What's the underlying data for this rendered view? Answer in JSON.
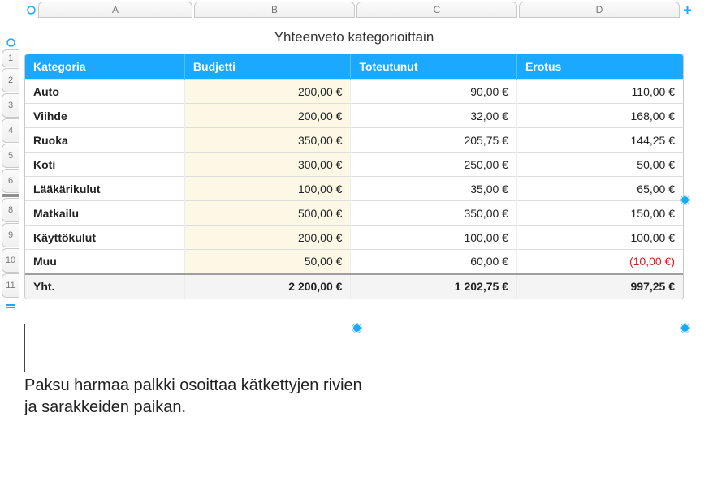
{
  "columns": [
    "A",
    "B",
    "C",
    "D"
  ],
  "row_numbers": [
    "1",
    "2",
    "3",
    "4",
    "5",
    "6",
    "8",
    "9",
    "10",
    "11"
  ],
  "hidden_gap_after_index": 5,
  "table": {
    "title": "Yhteenveto kategorioittain",
    "headers": [
      "Kategoria",
      "Budjetti",
      "Toteutunut",
      "Erotus"
    ],
    "rows": [
      {
        "cat": "Auto",
        "budget": "200,00 €",
        "actual": "90,00 €",
        "diff": "110,00 €",
        "neg": false
      },
      {
        "cat": "Viihde",
        "budget": "200,00 €",
        "actual": "32,00 €",
        "diff": "168,00 €",
        "neg": false
      },
      {
        "cat": "Ruoka",
        "budget": "350,00 €",
        "actual": "205,75 €",
        "diff": "144,25 €",
        "neg": false
      },
      {
        "cat": "Koti",
        "budget": "300,00 €",
        "actual": "250,00 €",
        "diff": "50,00 €",
        "neg": false
      },
      {
        "cat": "Lääkärikulut",
        "budget": "100,00 €",
        "actual": "35,00 €",
        "diff": "65,00 €",
        "neg": false
      },
      {
        "cat": "Matkailu",
        "budget": "500,00 €",
        "actual": "350,00 €",
        "diff": "150,00 €",
        "neg": false
      },
      {
        "cat": "Käyttökulut",
        "budget": "200,00 €",
        "actual": "100,00 €",
        "diff": "100,00 €",
        "neg": false
      },
      {
        "cat": "Muu",
        "budget": "50,00 €",
        "actual": "60,00 €",
        "diff": "(10,00 €)",
        "neg": true
      }
    ],
    "total": {
      "cat": "Yht.",
      "budget": "2 200,00 €",
      "actual": "1 202,75 €",
      "diff": "997,25 €"
    }
  },
  "caption": "Paksu harmaa palkki osoittaa kätkettyjen rivien ja sarakkeiden paikan."
}
